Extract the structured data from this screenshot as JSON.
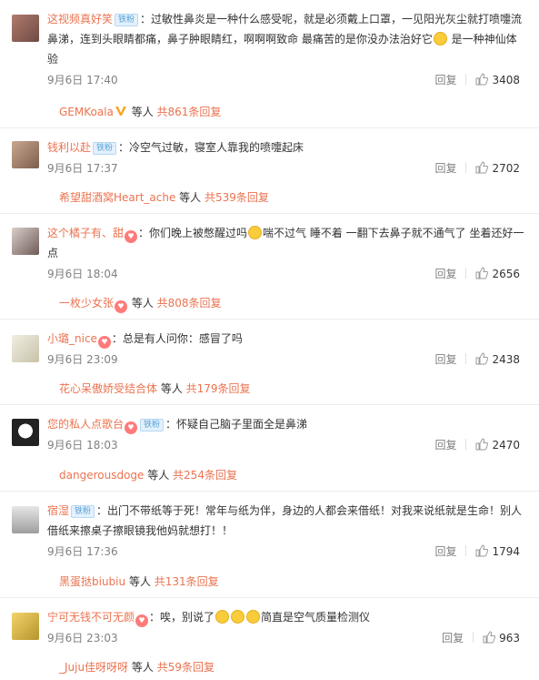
{
  "colors": {
    "username": "#eb7350",
    "badge_bg": "#e3f1fd",
    "badge_text": "#5aa2d4",
    "muted": "#808080"
  },
  "comments": [
    {
      "username": "这视频真好笑",
      "badge": "铁粉",
      "vip": false,
      "text_a": "：过敏性鼻炎是一种什么感受呢，就是必须戴上口罩，一见阳光灰尘就打喷嚏流鼻涕，连到头眼睛都痛，鼻子肿眼睛红，啊啊啊致命 最痛苦的是你没办法治好它",
      "emoji_a": "crying-face",
      "text_b": " 是一种神仙体验",
      "time": "9月6日 17:40",
      "reply": "回复",
      "likes": "3408",
      "sub_user": "GEMKoala",
      "sub_verified": true,
      "sub_mid": " 等人 ",
      "sub_count": "共861条回复"
    },
    {
      "username": "钱利以赴",
      "badge": "铁粉",
      "vip": false,
      "text_a": "：冷空气过敏，寝室人靠我的喷嚏起床",
      "time": "9月6日 17:37",
      "reply": "回复",
      "likes": "2702",
      "sub_user": "希望甜酒窝Heart_ache",
      "sub_mid": " 等人 ",
      "sub_count": "共539条回复"
    },
    {
      "username": "这个橘子有、甜",
      "vip": true,
      "text_a": "：你们晚上被憋醒过吗",
      "emoji_a": "crying-face",
      "text_b": "喘不过气  睡不着  一翻下去鼻子就不通气了  坐着还好一点",
      "time": "9月6日 18:04",
      "reply": "回复",
      "likes": "2656",
      "sub_user": "一枚少女张",
      "sub_vip": true,
      "sub_mid": " 等人 ",
      "sub_count": "共808条回复"
    },
    {
      "username": "小璐_nice",
      "vip": true,
      "text_a": "：总是有人问你：感冒了吗",
      "time": "9月6日 23:09",
      "reply": "回复",
      "likes": "2438",
      "sub_user": "花心呆傲娇受结合体",
      "sub_mid": " 等人 ",
      "sub_count": "共179条回复"
    },
    {
      "username": "您的私人点歌台",
      "badge": "铁粉",
      "vip": true,
      "text_a": "：怀疑自己脑子里面全是鼻涕",
      "time": "9月6日 18:03",
      "reply": "回复",
      "likes": "2470",
      "sub_user": "dangerousdoge",
      "sub_mid": " 等人 ",
      "sub_count": "共254条回复"
    },
    {
      "username": "宿湿",
      "badge": "铁粉",
      "vip": false,
      "text_a": "：出门不带纸等于死！常年与纸为伴，身边的人都会来借纸！对我来说纸就是生命！别人借纸来擦桌子擦眼镜我他妈就想打！！",
      "time": "9月6日 17:36",
      "reply": "回复",
      "likes": "1794",
      "sub_user": "黑蛋挞biubiu",
      "sub_mid": " 等人 ",
      "sub_count": "共131条回复"
    },
    {
      "username": "宁可无钱不可无颜",
      "vip": true,
      "text_a": "：唉，别说了",
      "emoji_triple": true,
      "text_b": "简直是空气质量检测仪",
      "time": "9月6日 23:03",
      "reply": "回复",
      "likes": "963",
      "sub_user": "_Juju佳呀呀呀",
      "sub_mid": " 等人 ",
      "sub_count": "共59条回复"
    }
  ]
}
